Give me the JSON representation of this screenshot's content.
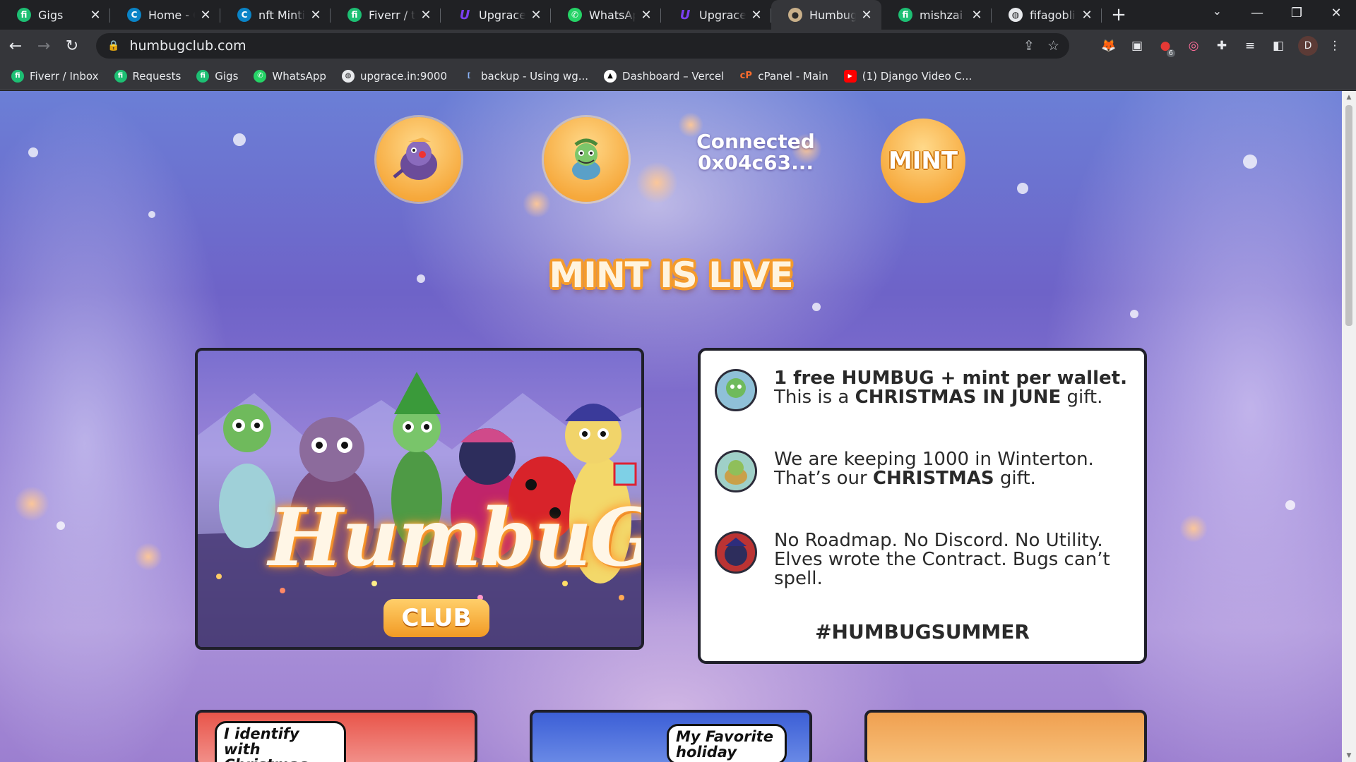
{
  "browser": {
    "tabs": [
      {
        "title": "Gigs",
        "icon": "fiverr-icon",
        "active": false
      },
      {
        "title": "Home - Canva",
        "icon": "canva-icon",
        "active": false
      },
      {
        "title": "nft Minting",
        "icon": "canva-icon",
        "active": false
      },
      {
        "title": "Fiverr / the",
        "icon": "fiverr-icon",
        "active": false
      },
      {
        "title": "Upgrace | P",
        "icon": "upgrace-icon",
        "active": false
      },
      {
        "title": "WhatsApp",
        "icon": "whatsapp-icon",
        "active": false
      },
      {
        "title": "Upgrace | P",
        "icon": "upgrace-icon",
        "active": false
      },
      {
        "title": "Humbug Cl",
        "icon": "humbug-icon",
        "active": true
      },
      {
        "title": "mishzai | Pr",
        "icon": "fiverr-icon",
        "active": false
      },
      {
        "title": "fifagoblin",
        "icon": "globe-icon",
        "active": false
      }
    ],
    "new_tab_glyph": "+",
    "url": "humbugclub.com",
    "profile_initial": "D",
    "extension_badge": "6",
    "bookmarks": [
      {
        "label": "Fiverr / Inbox",
        "icon": "fiverr-icon"
      },
      {
        "label": "Requests",
        "icon": "fiverr-icon"
      },
      {
        "label": "Gigs",
        "icon": "fiverr-icon"
      },
      {
        "label": "WhatsApp",
        "icon": "whatsapp-icon"
      },
      {
        "label": "upgrace.in:9000",
        "icon": "globe-icon"
      },
      {
        "label": "backup - Using wg...",
        "icon": "bracket-icon"
      },
      {
        "label": "Dashboard – Vercel",
        "icon": "vercel-icon"
      },
      {
        "label": "cPanel - Main",
        "icon": "cpanel-icon"
      },
      {
        "label": "(1) Django Video C...",
        "icon": "youtube-icon"
      }
    ]
  },
  "site": {
    "connected_label": "Connected",
    "wallet_address": "0x04c63...",
    "mint_button": "MINT",
    "banner": "MINT IS LIVE",
    "hero_logo": "HumbuG",
    "hero_club": "CLUB",
    "info": [
      {
        "bold1": "1 free HUMBUG + mint per wallet.",
        "line2_pre": "This is a ",
        "line2_bold": "CHRISTMAS IN JUNE",
        "line2_post": " gift."
      },
      {
        "line1": "We are keeping 1000 in Winterton.",
        "line2_pre": "That’s our ",
        "line2_bold": "CHRISTMAS",
        "line2_post": " gift."
      },
      {
        "text": "No Roadmap. No Discord. No Utility. Elves wrote the Contract. Bugs can’t spell."
      }
    ],
    "hashtag": "#HUMBUGSUMMER",
    "comics": [
      {
        "bubble": "I identify with Christmas"
      },
      {
        "bubble": "My Favorite holiday"
      },
      {
        "bubble": ""
      }
    ]
  },
  "colors": {
    "accent_orange": "#f6a83b",
    "card_border": "#1f1f2a",
    "chrome_dark": "#202124",
    "chrome_mid": "#35363a"
  }
}
